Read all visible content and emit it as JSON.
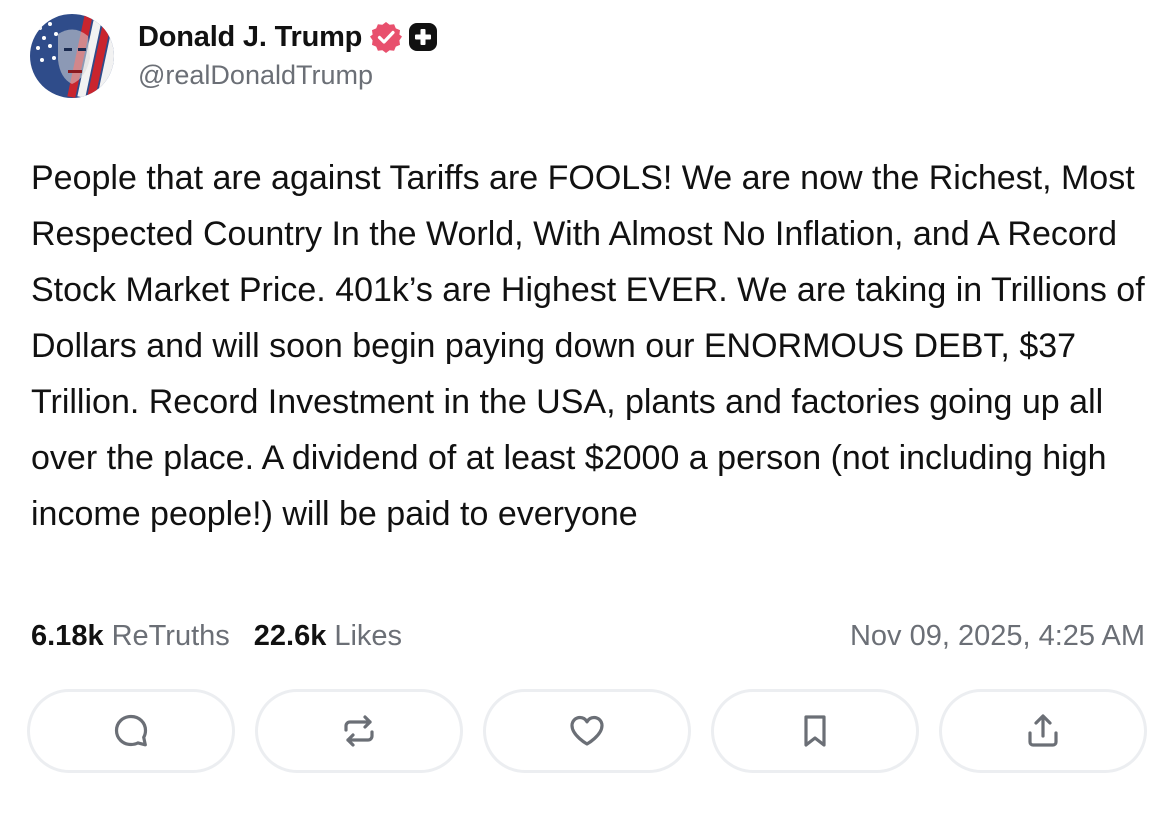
{
  "author": {
    "display_name": "Donald J. Trump",
    "handle": "@realDonaldTrump",
    "avatar_icon": "flag-portrait-avatar",
    "verified_icon": "verified-badge-icon",
    "verified_color": "#e8506d",
    "plus_icon": "plus-badge-icon"
  },
  "post": {
    "text": "People that are against Tariffs are FOOLS! We are now the Richest, Most Respected Country In the World, With Almost No Inflation, and A Record Stock Market Price. 401k’s are Highest EVER. We are taking in Trillions of Dollars and will soon begin paying down our ENORMOUS DEBT, $37 Trillion. Record Investment in the USA, plants and factories going up all over the place. A dividend of at least $2000 a person (not including high income people!) will be paid to everyone"
  },
  "stats": {
    "retruths_count": "6.18k",
    "retruths_label": "ReTruths",
    "likes_count": "22.6k",
    "likes_label": "Likes",
    "timestamp": "Nov 09, 2025, 4:25 AM"
  },
  "actions": [
    {
      "name": "reply",
      "icon": "comment-icon"
    },
    {
      "name": "retruth",
      "icon": "repost-icon"
    },
    {
      "name": "like",
      "icon": "heart-icon"
    },
    {
      "name": "bookmark",
      "icon": "bookmark-icon"
    },
    {
      "name": "share",
      "icon": "share-icon"
    }
  ],
  "colors": {
    "text": "#111111",
    "muted": "#6b6f76",
    "button_border": "#eceef1",
    "icon": "#6b6f76"
  }
}
